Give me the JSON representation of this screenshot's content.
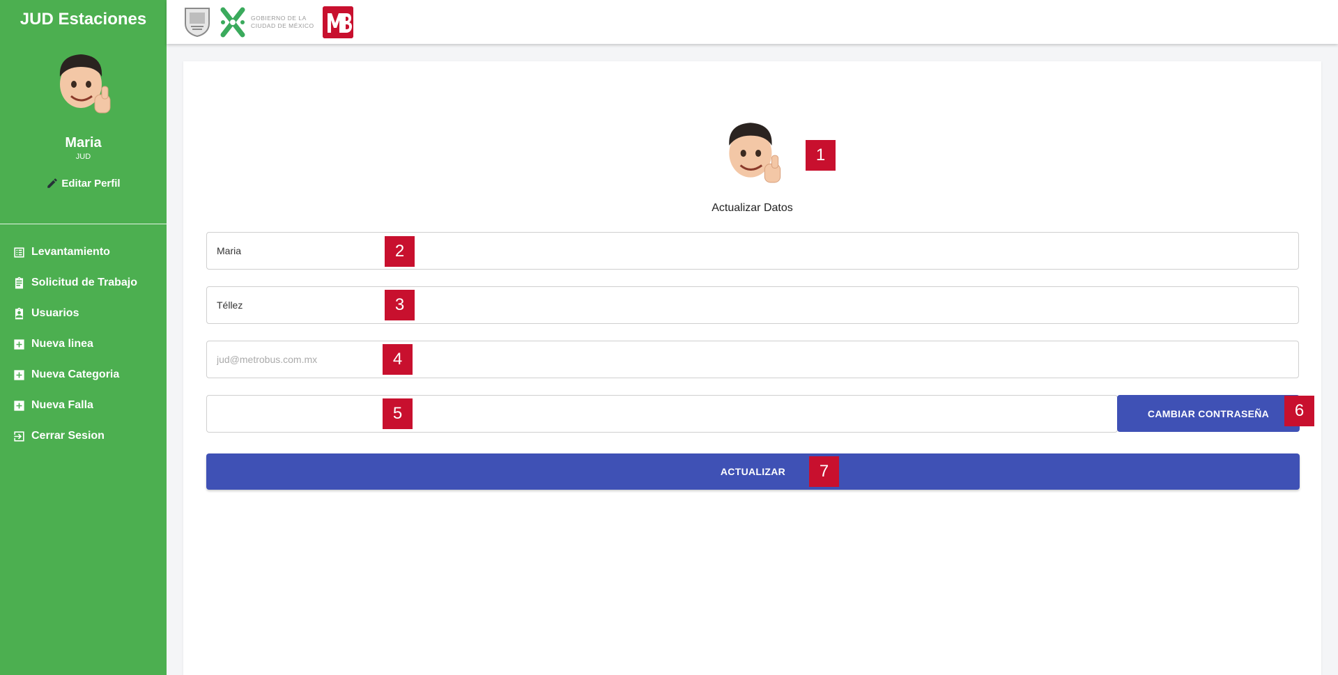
{
  "sidebar": {
    "brand": "JUD Estaciones",
    "user_name": "Maria",
    "user_role": "JUD",
    "edit_profile": "Editar Perfil",
    "items": [
      {
        "label": "Levantamiento",
        "icon": "list-icon"
      },
      {
        "label": "Solicitud de Trabajo",
        "icon": "clipboard-icon"
      },
      {
        "label": "Usuarios",
        "icon": "user-badge-icon"
      },
      {
        "label": "Nueva linea",
        "icon": "plus-box-icon"
      },
      {
        "label": "Nueva Categoria",
        "icon": "plus-box-icon"
      },
      {
        "label": "Nueva Falla",
        "icon": "plus-box-icon"
      },
      {
        "label": "Cerrar Sesion",
        "icon": "logout-icon"
      }
    ]
  },
  "topbar": {
    "cdmx_line1": "GOBIERNO DE LA",
    "cdmx_line2": "CIUDAD DE MÉXICO"
  },
  "form": {
    "title": "Actualizar Datos",
    "first_name": "Maria",
    "last_name": "Téllez",
    "email_placeholder": "jud@metrobus.com.mx",
    "password": "",
    "change_password_label": "CAMBIAR CONTRASEÑA",
    "update_label": "ACTUALIZAR"
  },
  "markers": [
    "1",
    "2",
    "3",
    "4",
    "5",
    "6",
    "7"
  ],
  "colors": {
    "sidebar": "#4caf50",
    "primary": "#3f51b5",
    "marker": "#c8102e",
    "metrobus": "#c8102e",
    "cdmx_green": "#3aaa5c"
  }
}
